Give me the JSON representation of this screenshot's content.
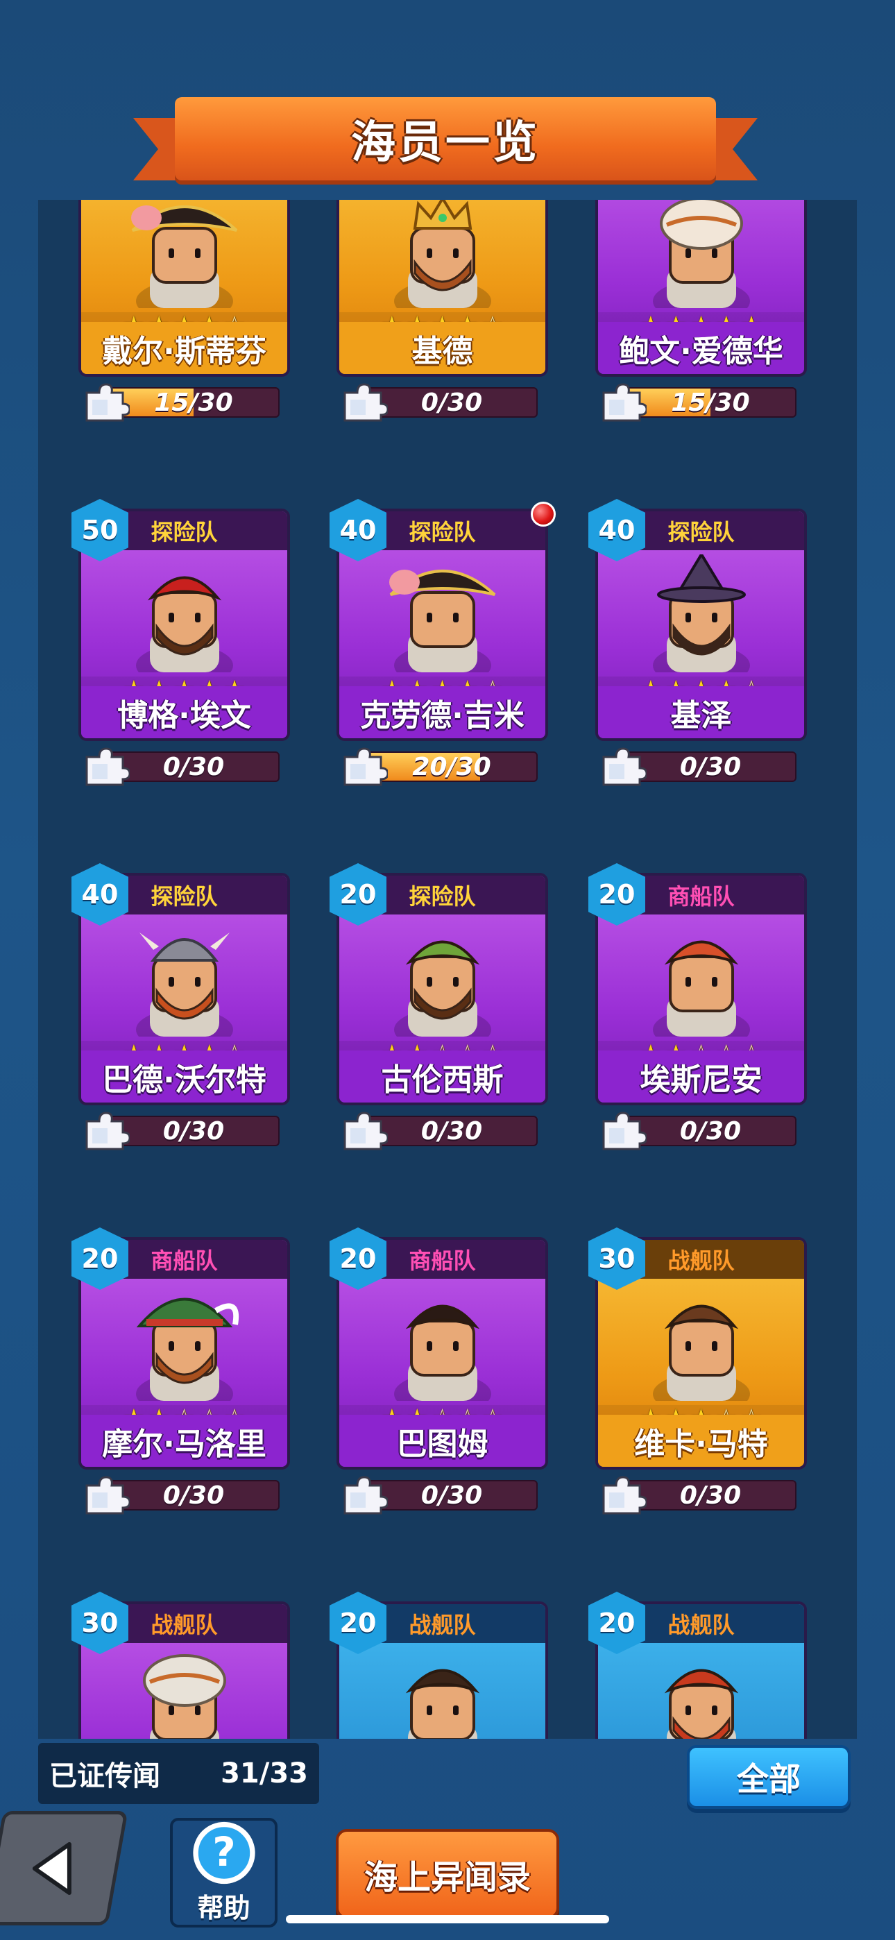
{
  "header": {
    "title": "海员一览"
  },
  "crew_rows": [
    [
      {
        "name": "戴尔·斯蒂芬",
        "faction": "",
        "level": "",
        "stars": 4,
        "color": "gold",
        "progress": "15/30",
        "progress_fraction": 0.5,
        "portrait": "pirate-captain-tricorn-hat"
      },
      {
        "name": "基德",
        "faction": "",
        "level": "",
        "stars": 4,
        "color": "gold",
        "progress": "0/30",
        "progress_fraction": 0,
        "portrait": "bearded-king-crown"
      },
      {
        "name": "鲍文·爱德华",
        "faction": "",
        "level": "",
        "stars": 5,
        "color": "purple",
        "progress": "15/30",
        "progress_fraction": 0.5,
        "portrait": "turban-merchant"
      }
    ],
    [
      {
        "name": "博格·埃文",
        "faction": "探险队",
        "level": "50",
        "stars": 5,
        "color": "purple",
        "progress": "0/30",
        "progress_fraction": 0,
        "portrait": "bandana-eyepatch-pirate"
      },
      {
        "name": "克劳德·吉米",
        "faction": "探险队",
        "level": "40",
        "stars": 4,
        "color": "purple",
        "progress": "20/30",
        "progress_fraction": 0.67,
        "portrait": "tricorn-noble",
        "new_badge": true
      },
      {
        "name": "基泽",
        "faction": "探险队",
        "level": "40",
        "stars": 4,
        "color": "purple",
        "progress": "0/30",
        "progress_fraction": 0,
        "portrait": "witch-hat-wizard"
      }
    ],
    [
      {
        "name": "巴德·沃尔特",
        "faction": "探险队",
        "level": "40",
        "stars": 4,
        "color": "purple",
        "progress": "0/30",
        "progress_fraction": 0,
        "portrait": "viking-helmet-bearded"
      },
      {
        "name": "古伦西斯",
        "faction": "探险队",
        "level": "20",
        "stars": 2,
        "color": "purple",
        "progress": "0/30",
        "progress_fraction": 0,
        "portrait": "bandana-mustache-sailor"
      },
      {
        "name": "埃斯尼安",
        "faction": "商船队",
        "level": "20",
        "stars": 2,
        "color": "purple",
        "progress": "0/30",
        "progress_fraction": 0,
        "portrait": "red-hair-sailor"
      }
    ],
    [
      {
        "name": "摩尔·马洛里",
        "faction": "商船队",
        "level": "20",
        "stars": 2,
        "color": "purple",
        "progress": "0/30",
        "progress_fraction": 0,
        "portrait": "green-feather-hat"
      },
      {
        "name": "巴图姆",
        "faction": "商船队",
        "level": "20",
        "stars": 2,
        "color": "purple",
        "progress": "0/30",
        "progress_fraction": 0,
        "portrait": "curly-hair-woman"
      },
      {
        "name": "维卡·马特",
        "faction": "战舰队",
        "level": "30",
        "stars": 3,
        "color": "gold",
        "progress": "0/30",
        "progress_fraction": 0,
        "portrait": "headband-warrior"
      }
    ],
    [
      {
        "name": "",
        "faction": "战舰队",
        "level": "30",
        "stars": 0,
        "color": "purple",
        "progress": "",
        "progress_fraction": 0,
        "portrait": "white-helmet-soldier"
      },
      {
        "name": "",
        "faction": "战舰队",
        "level": "20",
        "stars": 0,
        "color": "blue",
        "progress": "",
        "progress_fraction": 0,
        "portrait": "dark-hair-sailor"
      },
      {
        "name": "",
        "faction": "战舰队",
        "level": "20",
        "stars": 0,
        "color": "blue",
        "progress": "",
        "progress_fraction": 0,
        "portrait": "red-bearded-brute"
      }
    ]
  ],
  "footer": {
    "proven_label": "已证传闻",
    "proven_count": "31/33",
    "all_button": "全部",
    "help_label": "帮助",
    "help_glyph": "?",
    "sea_button": "海上异闻录"
  }
}
